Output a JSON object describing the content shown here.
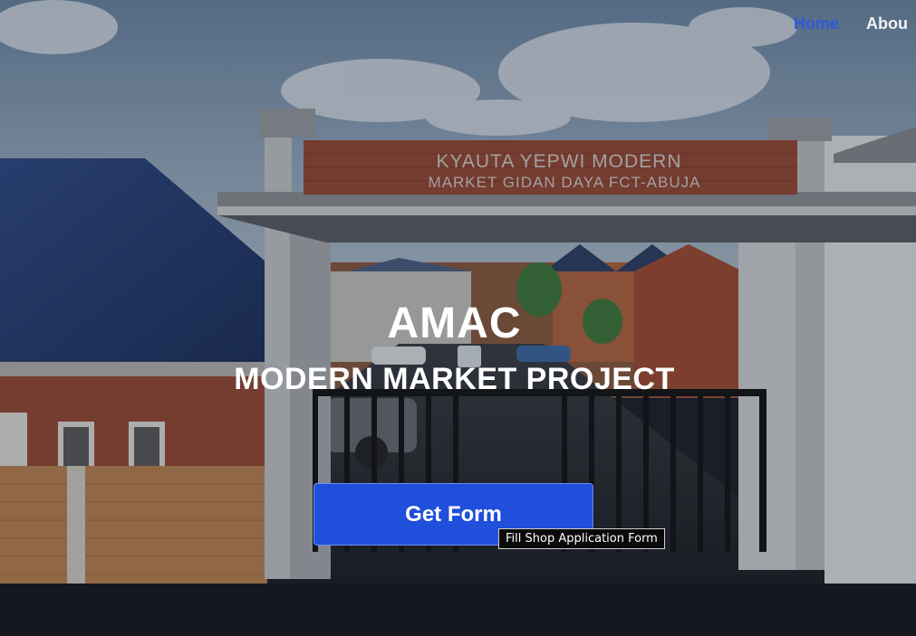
{
  "nav": {
    "items": [
      {
        "label": "Home",
        "active": true
      },
      {
        "label": "Abou",
        "active": false
      }
    ]
  },
  "hero": {
    "sign_line1": "KYAUTA YEPWI MODERN",
    "sign_line2": "MARKET GIDAN DAYA  FCT-ABUJA",
    "title": "AMAC",
    "subtitle": "MODERN MARKET PROJECT",
    "cta_label": "Get Form",
    "cta_tooltip": "Fill Shop Application Form"
  },
  "colors": {
    "accent": "#1f4fdb",
    "nav_active": "#2f5ad8",
    "text": "#ffffff"
  }
}
